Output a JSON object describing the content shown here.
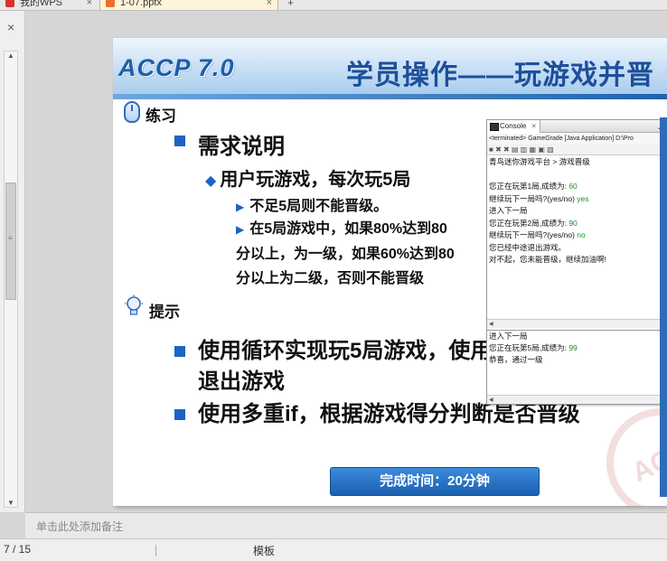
{
  "tabs": [
    {
      "label": "我的WPS"
    },
    {
      "label": "1-07.pptx"
    }
  ],
  "new_tab_symbol": "+",
  "close_symbol": "×",
  "slide": {
    "logo": "ACCP 7.0",
    "title": "学员操作——玩游戏并晋",
    "practice_label": "练习",
    "hint_label": "提示",
    "requirement_heading": "需求说明",
    "sub1": "用户玩游戏，每次玩5局",
    "sub2": "不足5局则不能晋级。",
    "sub3": "在5局游戏中，如果80%达到80分以上，为一级，如果60%达到80分以上为二级，否则不能晋级",
    "bullet1": "使用循环实现玩5局游戏，使用break语句实现中途退出游戏",
    "bullet2": "使用多重if，根据游戏得分判断是否晋级",
    "watermark": "ACC",
    "time_box": "完成时间：20分钟"
  },
  "console": {
    "tab_label": "Console",
    "status": "<terminated> GameGrade [Java Application] D:\\Pro",
    "lines": [
      {
        "text": "青鸟迷你游戏平台 > 游戏晋级",
        "input": ""
      },
      {
        "text": "",
        "input": ""
      },
      {
        "text": "您正在玩第1局,成绩为: ",
        "input": "60"
      },
      {
        "text": "继续玩下一局吗?(yes/no) ",
        "input": "yes"
      },
      {
        "text": "进入下一局",
        "input": ""
      },
      {
        "text": "您正在玩第2局,成绩为: ",
        "input": "90"
      },
      {
        "text": "继续玩下一局吗?(yes/no) ",
        "input": "no"
      },
      {
        "text": "您已经中途退出游戏。",
        "input": ""
      },
      {
        "text": "对不起，您未能晋级，继续加油啊!",
        "input": ""
      }
    ],
    "lines2": [
      {
        "text": "进入下一局",
        "input": ""
      },
      {
        "text": "您正在玩第5局,成绩为: ",
        "input": "99"
      },
      {
        "text": "恭喜，通过一级",
        "input": ""
      }
    ]
  },
  "notes_placeholder": "单击此处添加备注",
  "status": {
    "page": "7 / 15",
    "template": "模板"
  },
  "colors": {
    "accent_blue": "#1e63c4",
    "console_input": "#1a8f2e"
  }
}
